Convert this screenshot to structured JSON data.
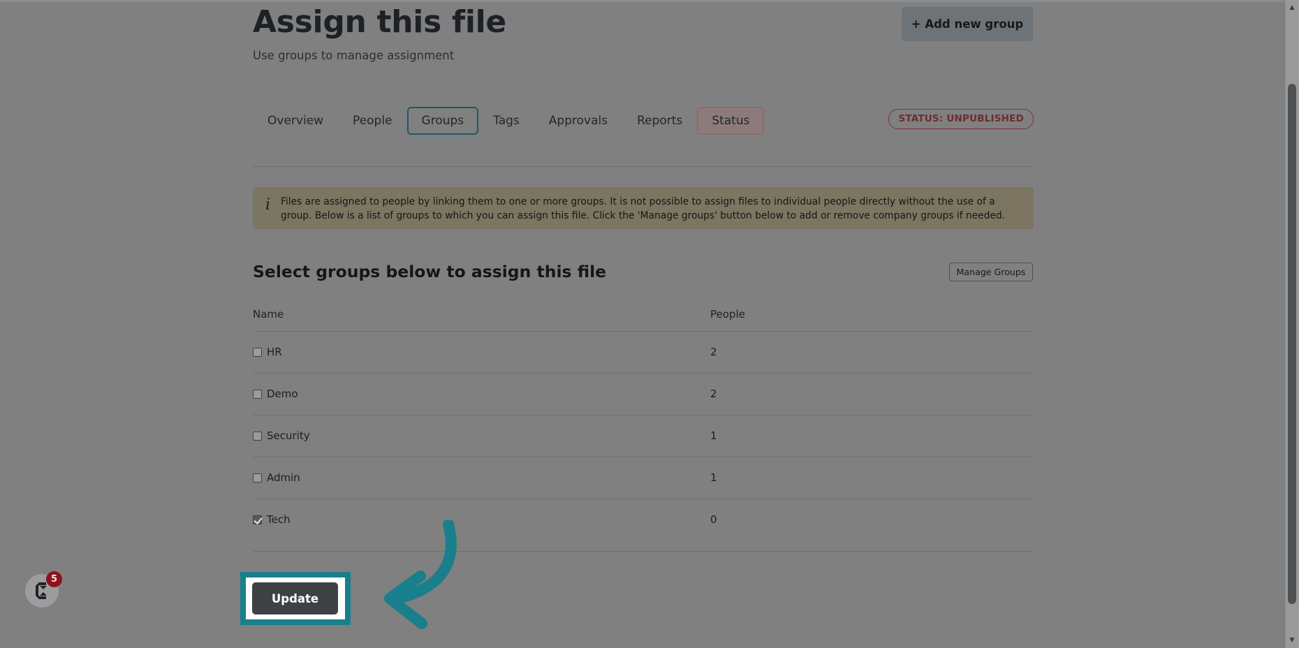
{
  "header": {
    "title": "Assign this file",
    "subtitle": "Use groups to manage assignment",
    "add_group_button": "+ Add new group"
  },
  "tabs": [
    {
      "label": "Overview",
      "active": false,
      "style": "plain"
    },
    {
      "label": "People",
      "active": false,
      "style": "plain"
    },
    {
      "label": "Groups",
      "active": true,
      "style": "outlined"
    },
    {
      "label": "Tags",
      "active": false,
      "style": "plain"
    },
    {
      "label": "Approvals",
      "active": false,
      "style": "plain"
    },
    {
      "label": "Reports",
      "active": false,
      "style": "plain"
    },
    {
      "label": "Status",
      "active": false,
      "style": "status"
    }
  ],
  "status_badge": {
    "label": "STATUS: UNPUBLISHED",
    "color": "#6e2b30"
  },
  "info_banner": {
    "icon": "info-icon",
    "text": "Files are assigned to people by linking them to one or more groups. It is not possible to assign files to individual people directly without the use of a group. Below is a list of groups to which you can assign this file. Click the 'Manage groups' button below to add or remove company groups if needed.",
    "background": "#7b7561"
  },
  "section": {
    "heading": "Select groups below to assign this file",
    "manage_groups_button": "Manage Groups"
  },
  "table": {
    "columns": [
      "Name",
      "People"
    ],
    "rows": [
      {
        "name": "HR",
        "people": "2",
        "checked": false
      },
      {
        "name": "Demo",
        "people": "2",
        "checked": false
      },
      {
        "name": "Security",
        "people": "1",
        "checked": false
      },
      {
        "name": "Admin",
        "people": "1",
        "checked": false
      },
      {
        "name": "Tech",
        "people": "0",
        "checked": true
      }
    ]
  },
  "footer": {
    "update_button": "Update"
  },
  "annotation": {
    "color": "#1a7f8c",
    "shape": "curved-arrow-pointing-left",
    "highlight_target": "update-button"
  },
  "chat_widget": {
    "badge_count": "5",
    "badge_color": "#8d1319",
    "icon": "chat-logo-icon"
  },
  "scrollbar": {
    "up_arrow": "▲",
    "down_arrow": "▼"
  },
  "colors": {
    "page_background": "#808080",
    "accent_teal": "#1a7f8c",
    "tab_active_border": "#1c5a63",
    "status_tab_background": "#8d7b7c",
    "banner": "#7b7561",
    "update_button": "#3f4245"
  }
}
